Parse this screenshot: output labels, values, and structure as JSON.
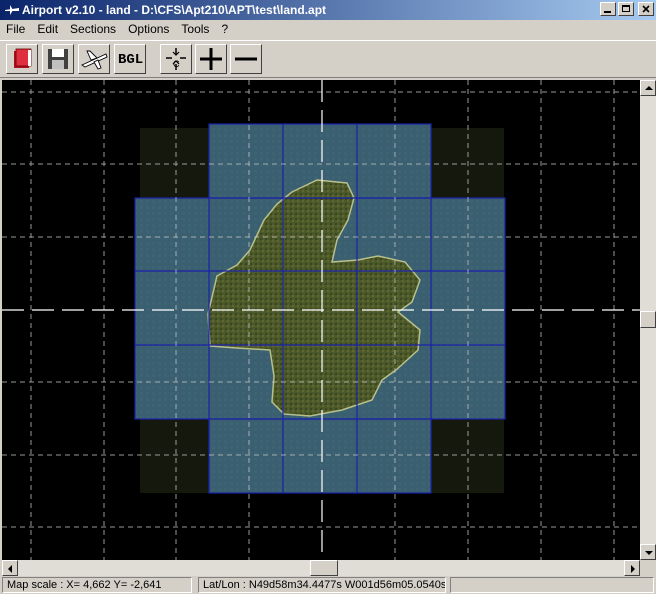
{
  "window": {
    "title": "Airport v2.10 - land - D:\\CFS\\Apt210\\APT\\test\\land.apt"
  },
  "menu": [
    "File",
    "Edit",
    "Sections",
    "Options",
    "Tools",
    "?"
  ],
  "toolbar": {
    "bgl_label": "BGL",
    "center_label": "C"
  },
  "status": {
    "map_scale": "Map scale : X= 4,662  Y= -2,641",
    "latlon": "Lat/Lon : N49d58m34.4477s  W001d56m05.0540s"
  },
  "colors": {
    "title_start": "#0a246a",
    "title_end": "#a6caf0",
    "tile_border": "#1a22a8",
    "sea": "#385d6c",
    "land": "#4f5a2c"
  },
  "icons": [
    "book-icon",
    "save-disk-icon",
    "airplane-icon",
    "bgl-icon",
    "center-crosshair-icon",
    "zoom-in-icon",
    "zoom-out-icon"
  ]
}
